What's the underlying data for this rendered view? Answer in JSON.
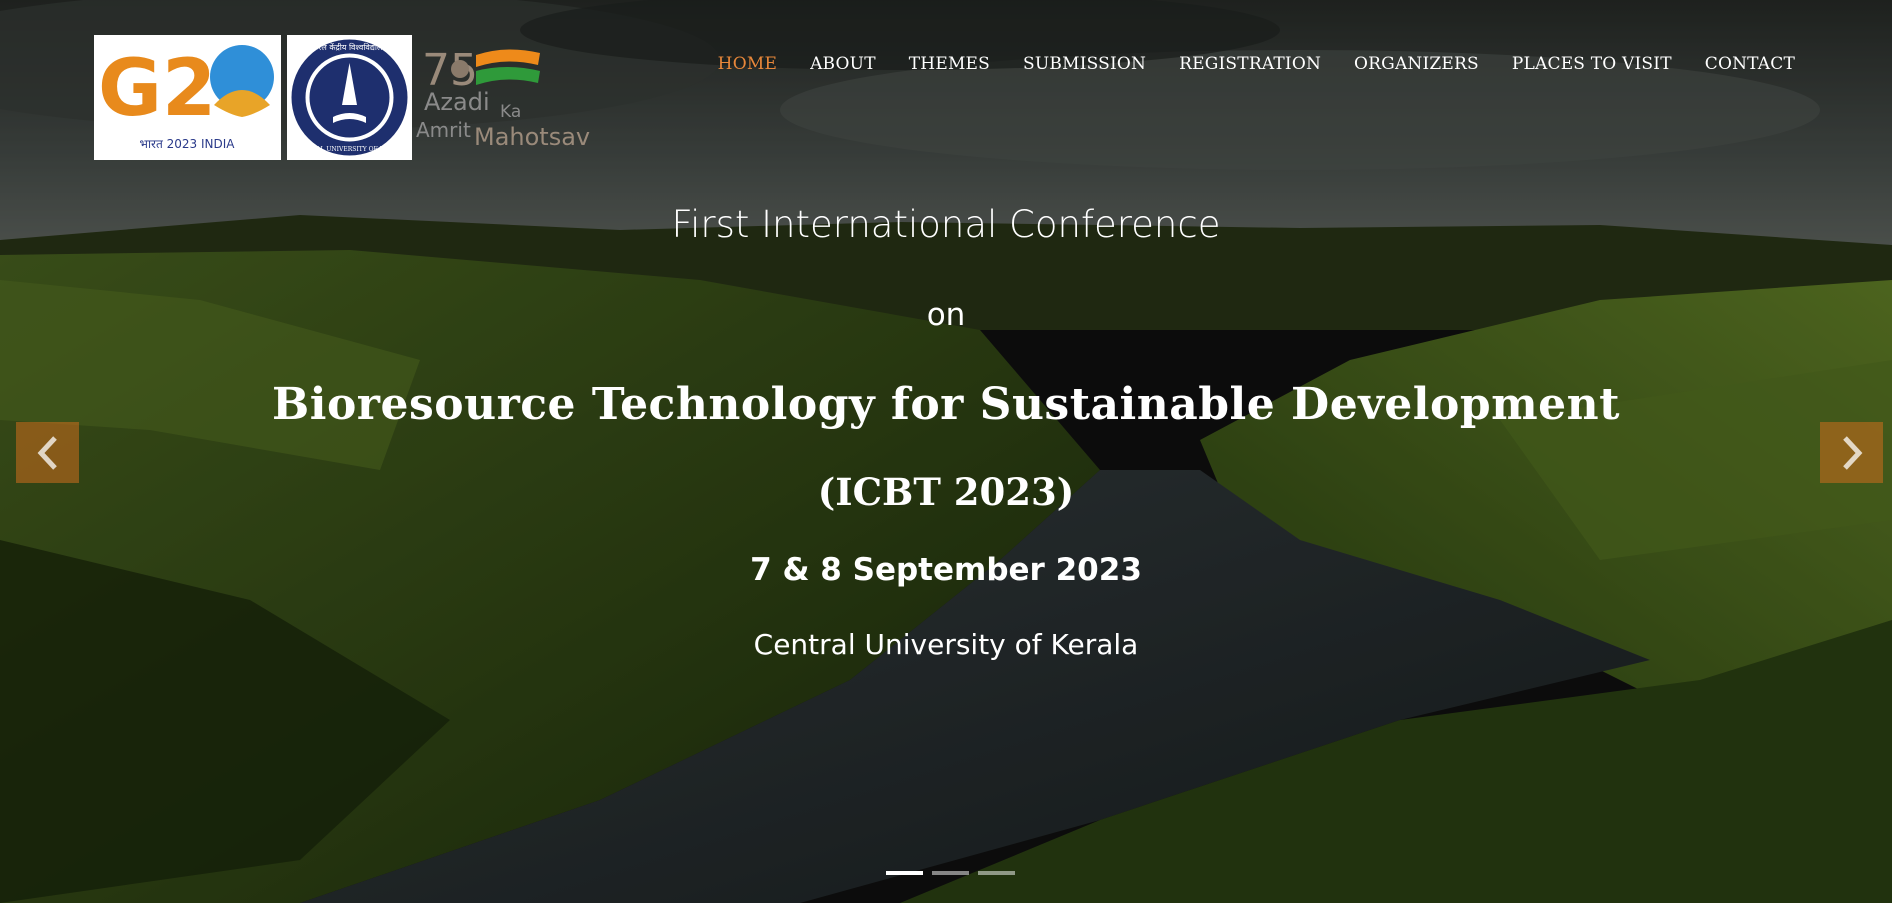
{
  "nav": {
    "items": [
      {
        "label": "HOME",
        "active": true
      },
      {
        "label": "ABOUT"
      },
      {
        "label": "THEMES"
      },
      {
        "label": "SUBMISSION"
      },
      {
        "label": "REGISTRATION"
      },
      {
        "label": "ORGANIZERS"
      },
      {
        "label": "PLACES TO VISIT"
      },
      {
        "label": "CONTACT"
      }
    ],
    "active_color": "#e8873a"
  },
  "logos": {
    "g20": {
      "mark": "G2",
      "caption": "भारत 2023 INDIA"
    },
    "cuk": {
      "top_text": "केरल केंद्रीय विश्वविद्यालय",
      "bottom_text": "CENTRAL UNIVERSITY OF KERALA"
    },
    "azadi": {
      "number": "75",
      "line1": "Azadi",
      "ka": "Ka",
      "line2": "Amrit",
      "line3": "Mahotsav"
    }
  },
  "hero": {
    "line1": "First International Conference",
    "line2": "on",
    "title": "Bioresource Technology for Sustainable Development",
    "acronym": "(ICBT 2023)",
    "dates": "7 & 8 September 2023",
    "venue": "Central University of Kerala"
  },
  "carousel": {
    "prev_icon": "chevron-left-icon",
    "next_icon": "chevron-right-icon",
    "slides": 3,
    "active_slide": 1,
    "arrow_color": "#cd6e1e"
  }
}
